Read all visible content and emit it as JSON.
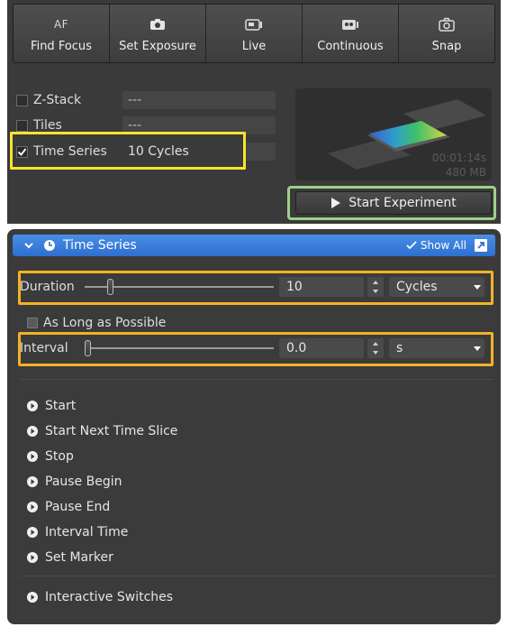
{
  "acquisition": {
    "buttons": [
      {
        "label": "Find Focus",
        "icon": "af-text-icon",
        "icon_text": "AF"
      },
      {
        "label": "Set Exposure",
        "icon": "camera-icon"
      },
      {
        "label": "Live",
        "icon": "live-camera-icon"
      },
      {
        "label": "Continuous",
        "icon": "continuous-camera-icon"
      },
      {
        "label": "Snap",
        "icon": "snap-camera-icon"
      }
    ]
  },
  "options": {
    "zstack": {
      "label": "Z-Stack",
      "value": "---",
      "checked": false
    },
    "tiles": {
      "label": "Tiles",
      "value": "---",
      "checked": false
    },
    "time_series": {
      "label": "Time Series",
      "value": "10 Cycles",
      "checked": true
    }
  },
  "preview": {
    "duration": "00:01:14s",
    "size": "480 MB"
  },
  "start_experiment": {
    "label": "Start Experiment",
    "icon": "play-icon"
  },
  "time_series_panel": {
    "title": "Time Series",
    "show_all": "Show All",
    "duration": {
      "label": "Duration",
      "value": "10",
      "unit": "Cycles",
      "slider_fraction": 0.12
    },
    "as_long_as_possible": {
      "label": "As Long as Possible",
      "checked": false
    },
    "interval": {
      "label": "Interval",
      "value": "0.0",
      "unit": "s",
      "slider_fraction": 0.0
    },
    "events": [
      "Start",
      "Start Next Time Slice",
      "Stop",
      "Pause Begin",
      "Pause End",
      "Interval Time",
      "Set Marker"
    ],
    "interactive_switches": "Interactive Switches"
  },
  "colors": {
    "highlight_yellow": "#f5e52a",
    "highlight_green": "#9ed08a",
    "highlight_orange": "#f3b226",
    "header_blue": "#2e6fcf"
  }
}
